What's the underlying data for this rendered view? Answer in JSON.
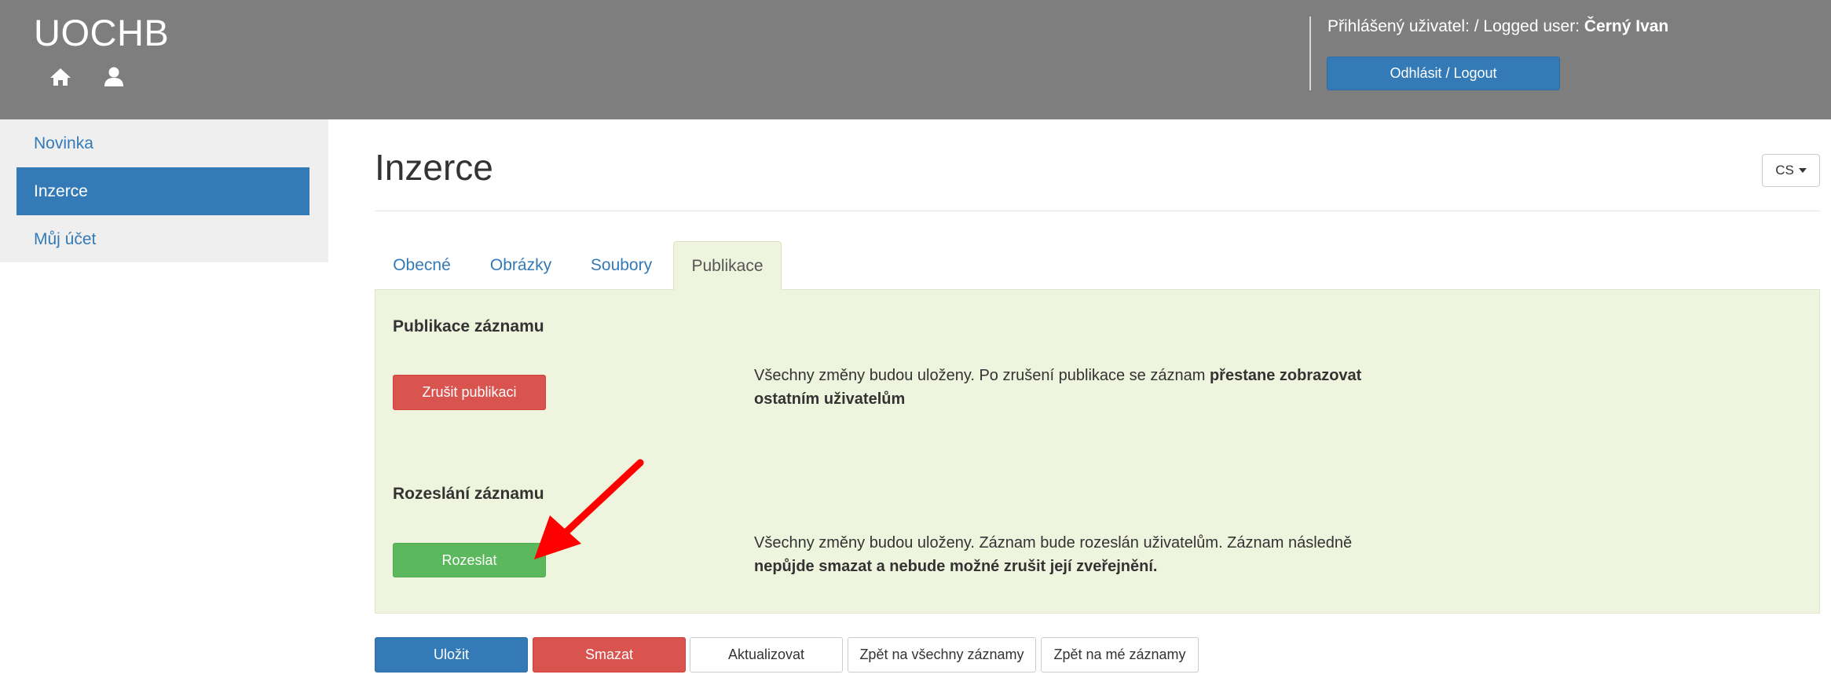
{
  "header": {
    "brand": "UOCHB",
    "home_icon": "home-icon",
    "user_icon": "user-icon",
    "user_label": "Přihlášený uživatel: / Logged user:",
    "user_name": "Černý Ivan",
    "logout_label": "Odhlásit / Logout"
  },
  "sidebar": {
    "items": [
      {
        "label": "Novinka"
      },
      {
        "label": "Inzerce"
      },
      {
        "label": "Můj účet"
      }
    ],
    "active_index": 1
  },
  "main": {
    "title": "Inzerce",
    "language": "CS",
    "tabs": [
      {
        "label": "Obecné"
      },
      {
        "label": "Obrázky"
      },
      {
        "label": "Soubory"
      },
      {
        "label": "Publikace"
      }
    ],
    "active_tab": "Publikace",
    "publication": {
      "title": "Publikace záznamu",
      "button": "Zrušit publikaci",
      "note_normal": "Všechny změny budou uloženy. Po zrušení publikace se záznam ",
      "note_bold_1": "přestane zobrazovat",
      "note_bold_2": "ostatním uživatelům"
    },
    "distribution": {
      "title": "Rozeslání záznamu",
      "button": "Rozeslat",
      "note_normal": "Všechny změny budou uloženy. Záznam bude rozeslán uživatelům. Záznam následně",
      "note_bold": "nepůjde smazat a nebude možné zrušit její zveřejnění."
    }
  },
  "actions": {
    "save": "Uložit",
    "delete": "Smazat",
    "refresh": "Aktualizovat",
    "back_all": "Zpět na všechny záznamy",
    "back_mine": "Zpět na mé záznamy"
  },
  "colors": {
    "header_bg": "#7f7e7f",
    "primary": "#337ab7",
    "danger": "#d9534f",
    "success": "#5cb85c",
    "panel_bg": "#eef4dd",
    "annotation_arrow": "#ff0000"
  }
}
